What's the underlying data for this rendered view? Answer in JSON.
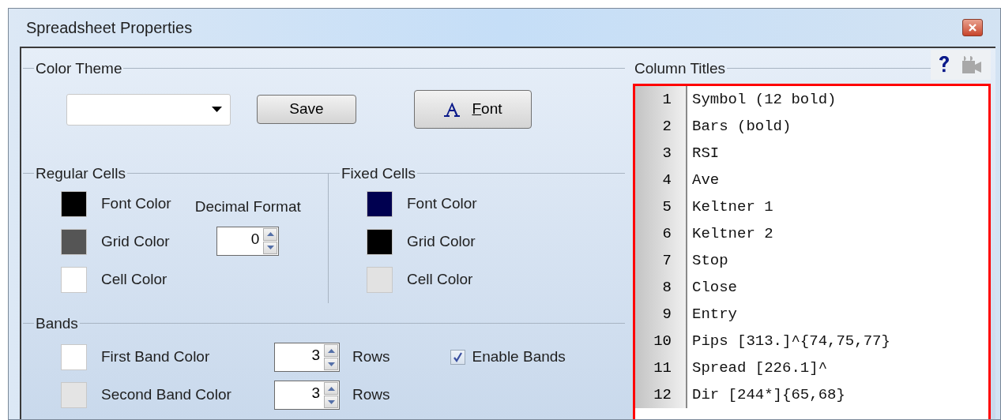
{
  "window": {
    "title": "Spreadsheet Properties"
  },
  "color_theme": {
    "label": "Color Theme",
    "save_button": "Save",
    "font_button": "Font"
  },
  "regular_cells": {
    "label": "Regular Cells",
    "colors": [
      {
        "label": "Font Color",
        "color": "#000000"
      },
      {
        "label": "Grid Color",
        "color": "#555555"
      },
      {
        "label": "Cell Color",
        "color": "#ffffff"
      }
    ],
    "decimal_format": {
      "label": "Decimal Format",
      "value": "0"
    }
  },
  "fixed_cells": {
    "label": "Fixed Cells",
    "colors": [
      {
        "label": "Font Color",
        "color": "#000050"
      },
      {
        "label": "Grid Color",
        "color": "#000000"
      },
      {
        "label": "Cell Color",
        "color": "#e2e2e2"
      }
    ]
  },
  "bands": {
    "label": "Bands",
    "rows": [
      {
        "label": "First Band Color",
        "color": "#ffffff",
        "count": "3",
        "unit": "Rows"
      },
      {
        "label": "Second Band Color",
        "color": "#e4e4e4",
        "count": "3",
        "unit": "Rows"
      }
    ],
    "enable_bands": {
      "label": "Enable Bands",
      "checked": true
    }
  },
  "column_titles": {
    "label": "Column Titles",
    "lines": [
      {
        "number": "1",
        "text": "Symbol (12 bold)"
      },
      {
        "number": "2",
        "text": "Bars (bold)"
      },
      {
        "number": "3",
        "text": "RSI"
      },
      {
        "number": "4",
        "text": "Ave"
      },
      {
        "number": "5",
        "text": "Keltner 1"
      },
      {
        "number": "6",
        "text": "Keltner 2"
      },
      {
        "number": "7",
        "text": "Stop"
      },
      {
        "number": "8",
        "text": "Close"
      },
      {
        "number": "9",
        "text": "Entry"
      },
      {
        "number": "10",
        "text": "Pips [313.]^{74,75,77}"
      },
      {
        "number": "11",
        "text": "Spread [226.1]^"
      },
      {
        "number": "12",
        "text": "Dir [244*]{65,68}"
      }
    ]
  }
}
